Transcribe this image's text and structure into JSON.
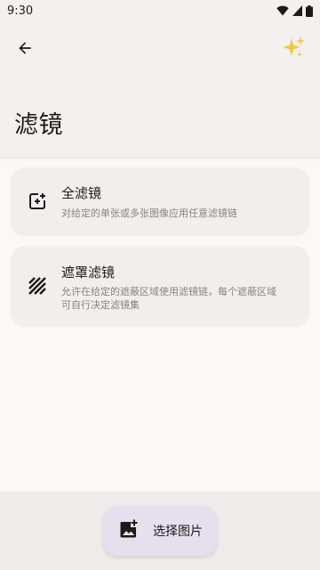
{
  "status_bar": {
    "time": "9:30"
  },
  "header": {
    "title": "滤镜",
    "icons": {
      "back": "back-arrow-icon",
      "sparkle": "sparkles-icon"
    },
    "sparkle_color": "#f5c542"
  },
  "cards": [
    {
      "title": "全滤镜",
      "subtitle": "对给定的单张或多张图像应用任意滤镜链",
      "icon": "add-filter-icon"
    },
    {
      "title": "遮罩滤镜",
      "subtitle": "允许在给定的遮蔽区域使用滤镜链，每个遮蔽区域可自行决定滤镜集",
      "icon": "mask-stripes-icon"
    }
  ],
  "fab": {
    "label": "选择图片",
    "icon": "add-photo-icon"
  },
  "colors": {
    "background": "#fcf8f7",
    "app_bar": "#f4f0ef",
    "card": "#f2eeed",
    "fab": "#e6e0ee"
  }
}
